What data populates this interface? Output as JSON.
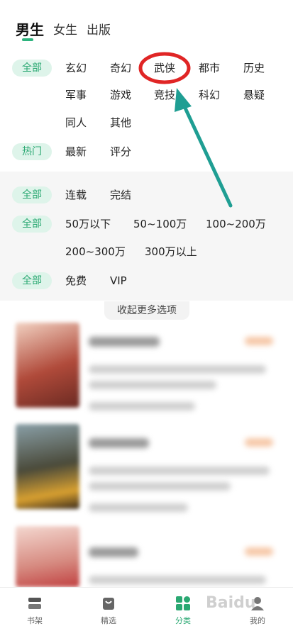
{
  "top_tabs": [
    "男生",
    "女生",
    "出版"
  ],
  "filters": {
    "row1": {
      "all": "全部",
      "options": [
        "玄幻",
        "奇幻",
        "武侠",
        "都市",
        "历史",
        "军事",
        "游戏",
        "竞技",
        "科幻",
        "悬疑",
        "同人",
        "其他"
      ]
    },
    "row2": {
      "hot": "热门",
      "options": [
        "最新",
        "评分"
      ]
    },
    "row3": {
      "all": "全部",
      "options": [
        "连载",
        "完结"
      ]
    },
    "row4": {
      "all": "全部",
      "options": [
        "50万以下",
        "50~100万",
        "100~200万",
        "200~300万",
        "300万以上"
      ]
    },
    "row5": {
      "all": "全部",
      "options": [
        "免费",
        "VIP"
      ]
    }
  },
  "collapse_label": "收起更多选项",
  "bottom_nav": [
    "书架",
    "精选",
    "分类",
    "我的"
  ],
  "watermark": "Baidu",
  "colors": {
    "accent": "#2aa872",
    "highlight_circle": "#e02525",
    "arrow": "#1f9e93"
  }
}
